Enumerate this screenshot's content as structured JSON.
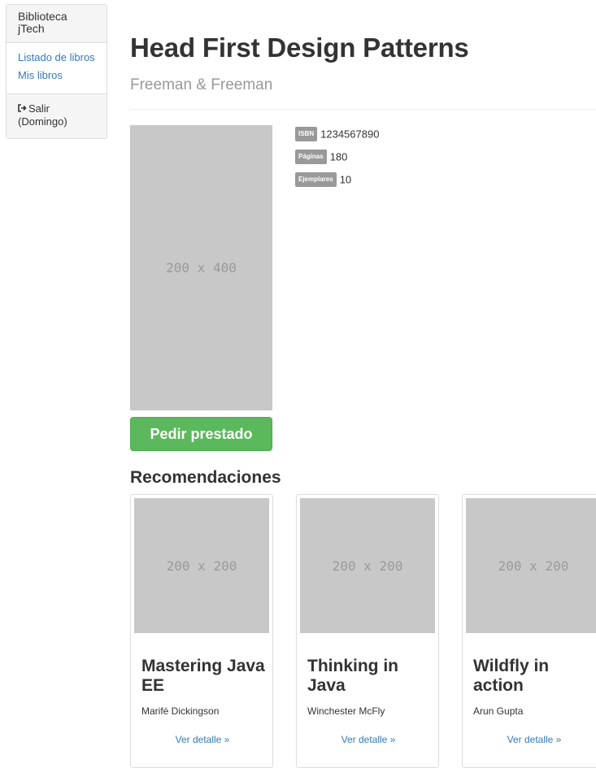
{
  "sidebar": {
    "brand": "Biblioteca jTech",
    "links": [
      "Listado de libros",
      "Mis libros"
    ],
    "logout_icon": "logout-icon",
    "logout_label": "Salir (Domingo)"
  },
  "book": {
    "title": "Head First Design Patterns",
    "author": "Freeman & Freeman",
    "cover_placeholder": "200 x 400",
    "meta": [
      {
        "label": "ISBN",
        "value": "1234567890"
      },
      {
        "label": "Páginas",
        "value": "180"
      },
      {
        "label": "Ejemplares",
        "value": "10"
      }
    ],
    "borrow_label": "Pedir prestado"
  },
  "recommendations": {
    "heading": "Recomendaciones",
    "items": [
      {
        "thumb": "200 x 200",
        "title": "Mastering Java EE",
        "author": "Marifé Dickingson",
        "link": "Ver detalle »"
      },
      {
        "thumb": "200 x 200",
        "title": "Thinking in Java",
        "author": "Winchester McFly",
        "link": "Ver detalle »"
      },
      {
        "thumb": "200 x 200",
        "title": "Wildfly in action",
        "author": "Arun Gupta",
        "link": "Ver detalle »"
      }
    ]
  },
  "colors": {
    "link": "#337ab7",
    "success": "#5cb85c",
    "placeholder": "#c8c8c8",
    "muted": "#999999"
  }
}
